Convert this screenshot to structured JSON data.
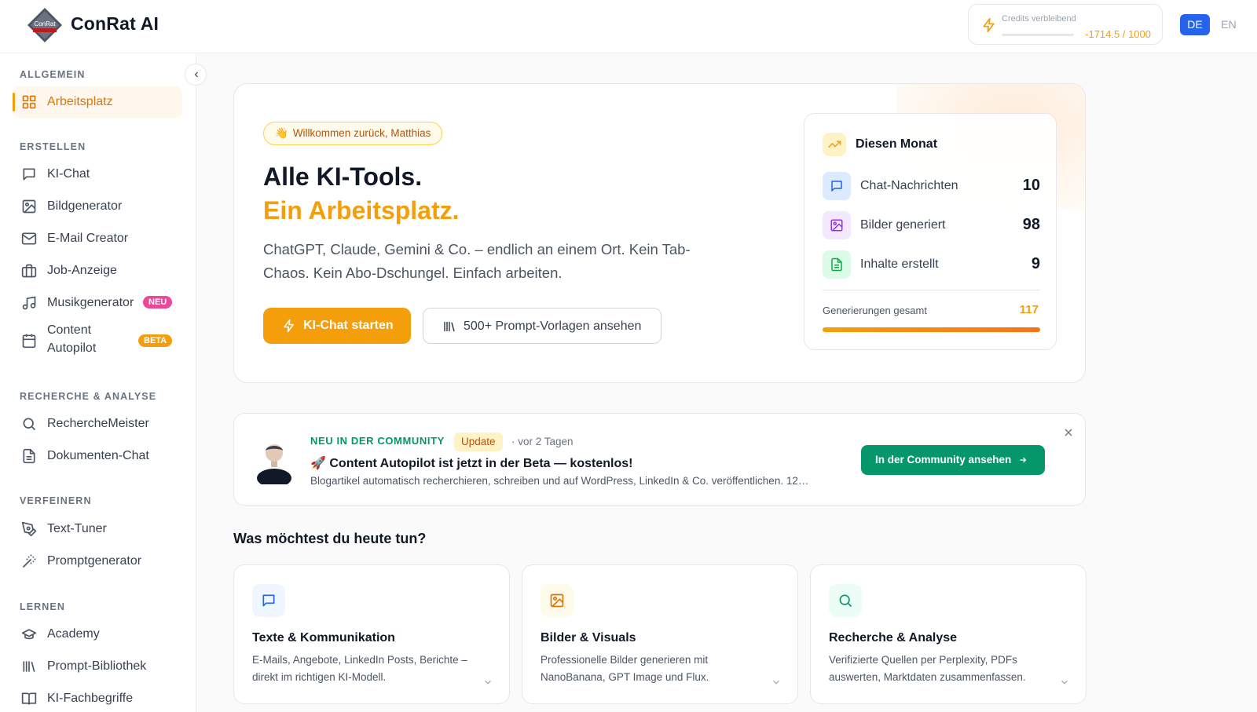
{
  "brand": {
    "name": "ConRat AI"
  },
  "credits": {
    "label": "Credits verbleibend",
    "value": "-1714.5 / 1000"
  },
  "language": {
    "active": "DE",
    "other": "EN"
  },
  "sidebar": {
    "sections": [
      {
        "title": "ALLGEMEIN",
        "items": [
          {
            "label": "Arbeitsplatz",
            "icon": "grid-icon",
            "active": true
          }
        ]
      },
      {
        "title": "ERSTELLEN",
        "items": [
          {
            "label": "KI-Chat",
            "icon": "chat-icon"
          },
          {
            "label": "Bildgenerator",
            "icon": "image-icon"
          },
          {
            "label": "E-Mail Creator",
            "icon": "mail-icon"
          },
          {
            "label": "Job-Anzeige",
            "icon": "briefcase-icon"
          },
          {
            "label": "Musikgenerator",
            "icon": "music-icon",
            "badge": "NEU"
          },
          {
            "label": "Content",
            "label2": "Autopilot",
            "icon": "calendar-icon",
            "badge": "BETA"
          }
        ]
      },
      {
        "title": "RECHERCHE & ANALYSE",
        "items": [
          {
            "label": "RechercheMeister",
            "icon": "search-icon"
          },
          {
            "label": "Dokumenten-Chat",
            "icon": "document-icon"
          }
        ]
      },
      {
        "title": "VERFEINERN",
        "items": [
          {
            "label": "Text-Tuner",
            "icon": "pen-tool-icon"
          },
          {
            "label": "Promptgenerator",
            "icon": "magic-wand-icon"
          }
        ]
      },
      {
        "title": "LERNEN",
        "items": [
          {
            "label": "Academy",
            "icon": "graduation-cap-icon"
          },
          {
            "label": "Prompt-Bibliothek",
            "icon": "library-icon"
          },
          {
            "label": "KI-Fachbegriffe",
            "icon": "book-icon"
          }
        ]
      }
    ]
  },
  "hero": {
    "welcome": "Willkommen zurück, Matthias",
    "title_line1": "Alle KI-Tools.",
    "title_line2": "Ein Arbeitsplatz.",
    "lead": "ChatGPT, Claude, Gemini & Co. – endlich an einem Ort. Kein Tab-Chaos. Kein Abo-Dschungel. Einfach arbeiten.",
    "primary_button": "KI-Chat starten",
    "secondary_button": "500+ Prompt-Vorlagen ansehen"
  },
  "stats": {
    "title": "Diesen Monat",
    "rows": [
      {
        "label": "Chat-Nachrichten",
        "value": "10",
        "icon": "chat-icon"
      },
      {
        "label": "Bilder generiert",
        "value": "98",
        "icon": "image-icon"
      },
      {
        "label": "Inhalte erstellt",
        "value": "9",
        "icon": "document-icon"
      }
    ],
    "total_label": "Generierungen gesamt",
    "total_value": "117",
    "progress": 1.0
  },
  "community": {
    "tag": "NEU IN DER COMMUNITY",
    "badge": "Update",
    "time": "· vor 2 Tagen",
    "title": "🚀 Content Autopilot ist jetzt in der Beta — kostenlos!",
    "description": "Blogartikel automatisch recherchieren, schreiben und auf WordPress, LinkedIn & Co. veröffentlichen. 12…",
    "button": "In der Community ansehen"
  },
  "section": {
    "title": "Was möchtest du heute tun?",
    "cards": [
      {
        "title": "Texte & Kommunikation",
        "description": "E-Mails, Angebote, LinkedIn Posts, Berichte – direkt im richtigen KI-Modell.",
        "icon": "chat-icon"
      },
      {
        "title": "Bilder & Visuals",
        "description": "Professionelle Bilder generieren mit NanoBanana, GPT Image und Flux.",
        "icon": "image-icon"
      },
      {
        "title": "Recherche & Analyse",
        "description": "Verifizierte Quellen per Perplexity, PDFs auswerten, Marktdaten zusammenfassen.",
        "icon": "search-icon"
      }
    ]
  },
  "colors": {
    "accent": "#f59e0b",
    "community": "#059669",
    "language_active": "#2563eb",
    "badge_new": "#ec4899"
  }
}
